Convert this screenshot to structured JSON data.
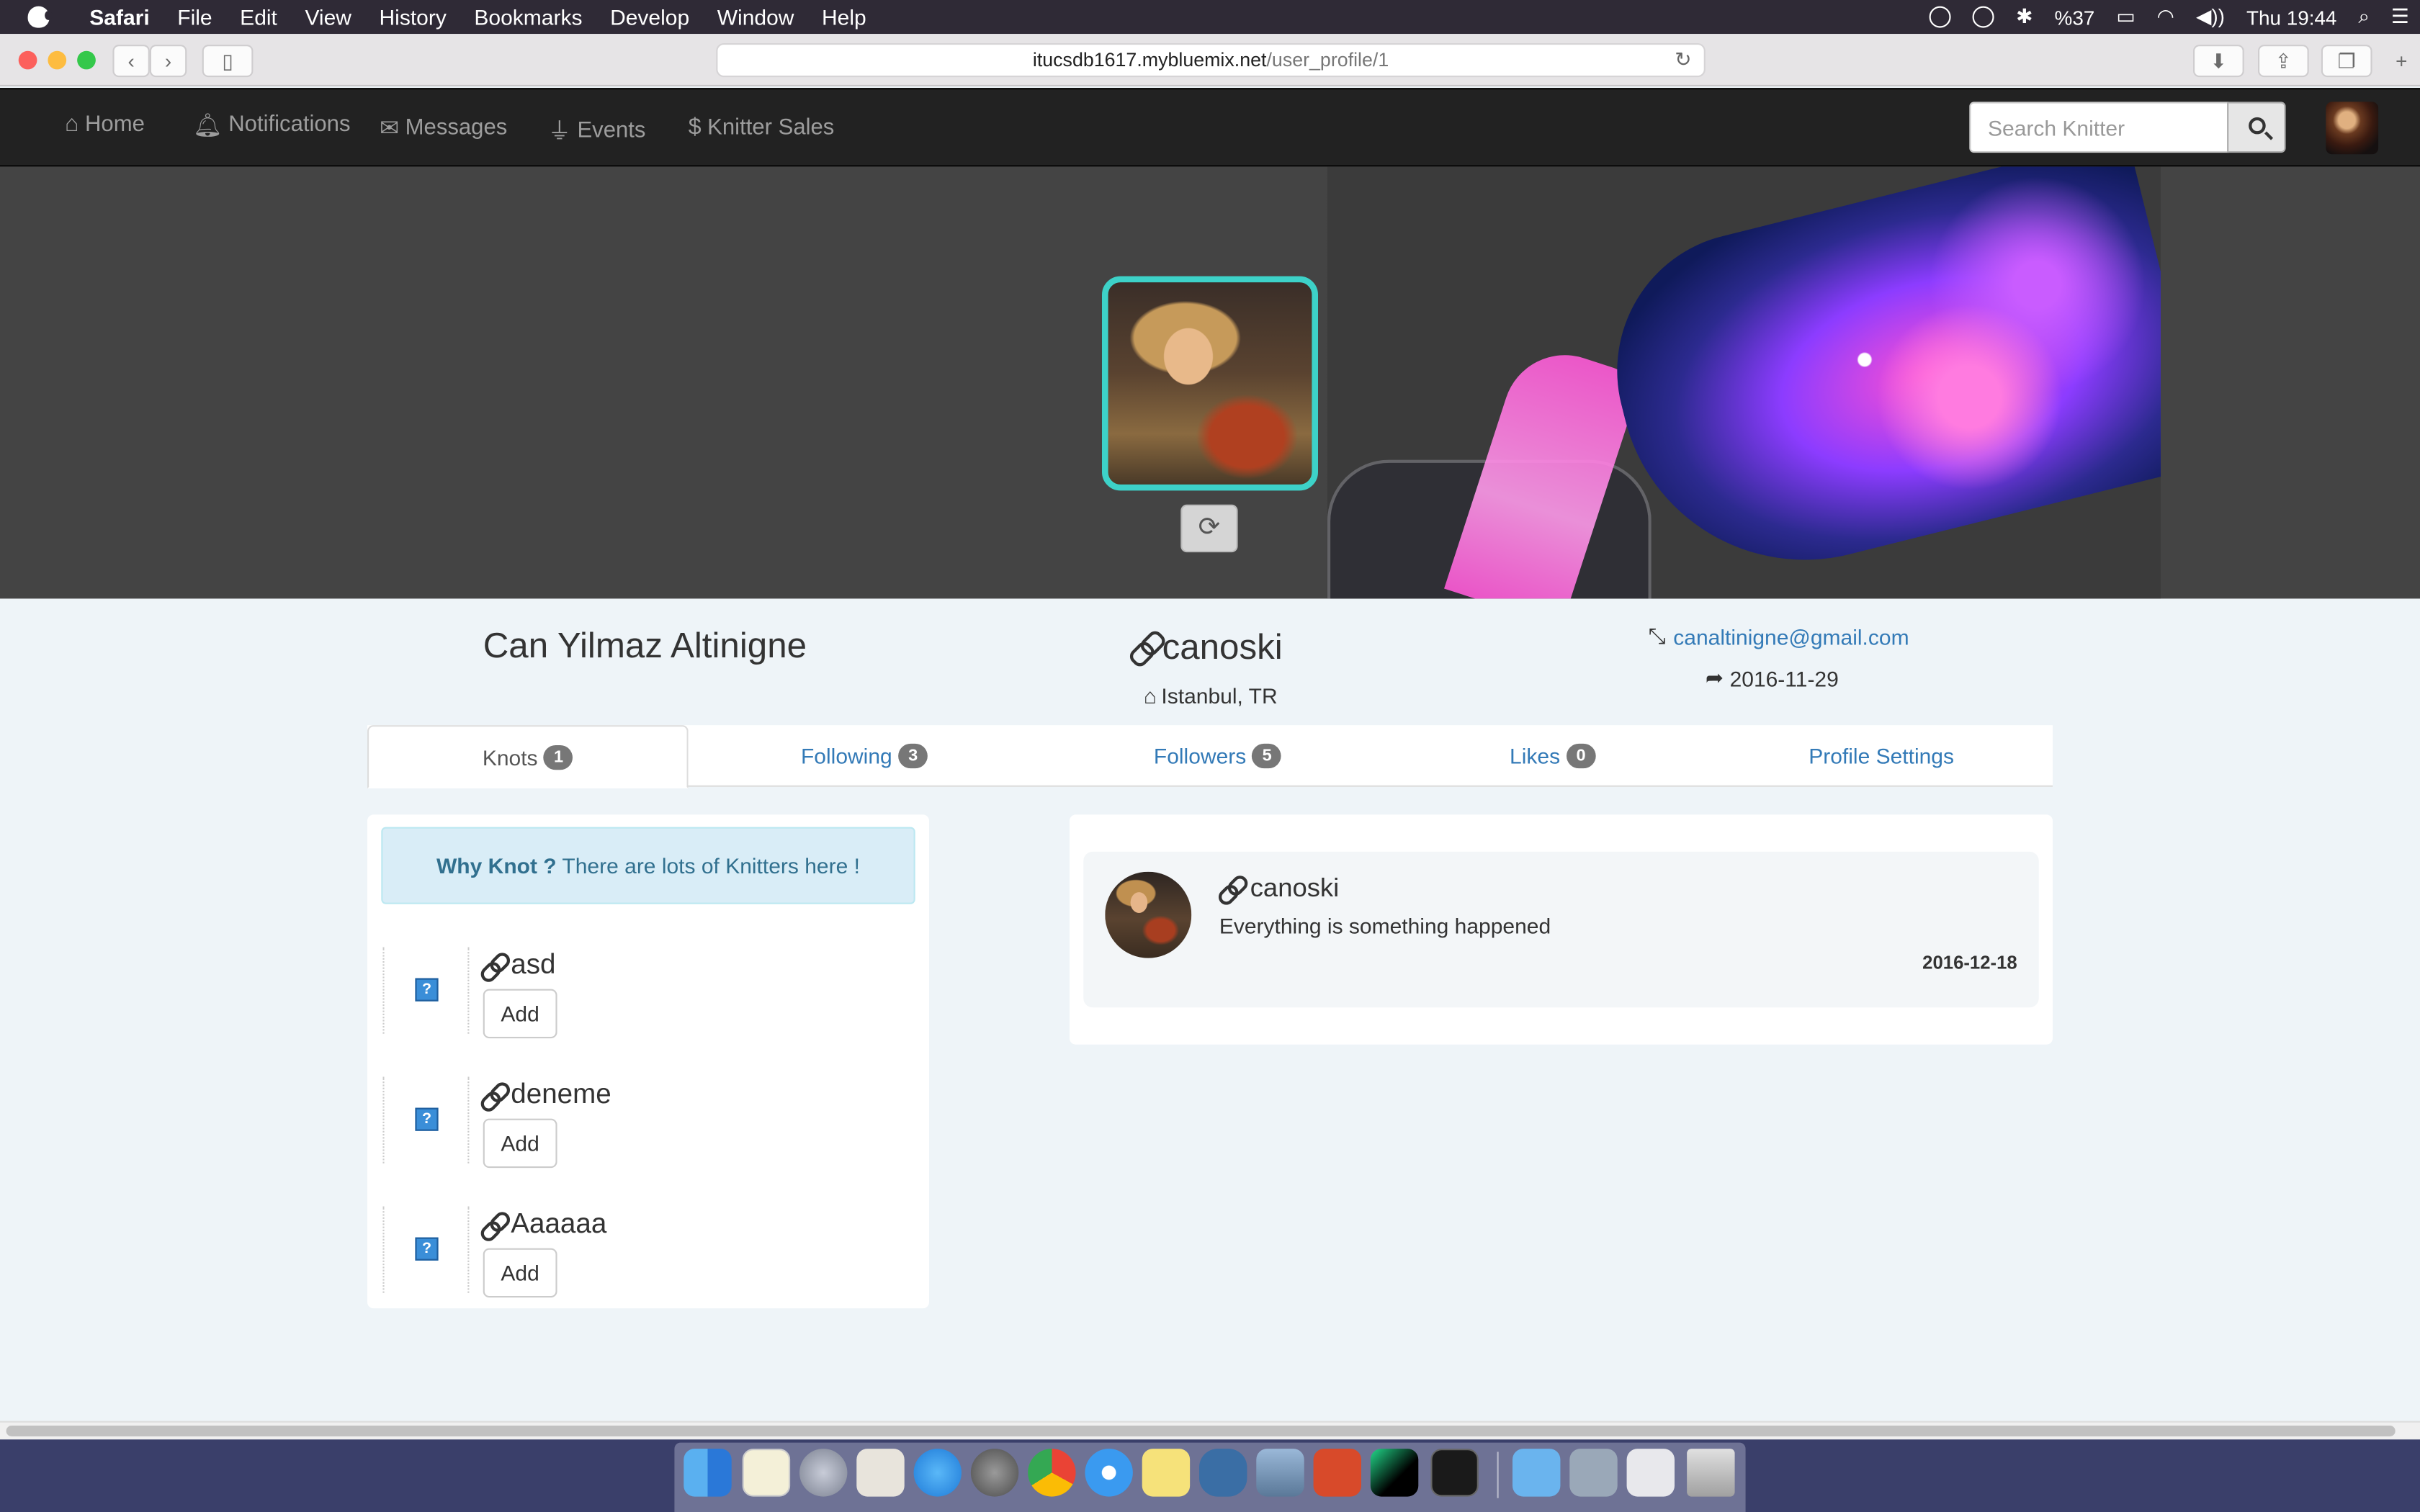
{
  "menubar": {
    "app": "Safari",
    "items": [
      "File",
      "Edit",
      "View",
      "History",
      "Bookmarks",
      "Develop",
      "Window",
      "Help"
    ],
    "battery": "%37",
    "clock": "Thu 19:44"
  },
  "browser": {
    "url_host": "itucsdb1617.mybluemix.net",
    "url_path": "/user_profile/1"
  },
  "nav": {
    "home": "Home",
    "notifications": "Notifications",
    "messages": "Messages",
    "events": "Events",
    "sales": "Knitter Sales",
    "search_placeholder": "Search Knitter"
  },
  "profile": {
    "full_name": "Can Yilmaz Altinigne",
    "username": "canoski",
    "location": "Istanbul, TR",
    "email": "canaltinigne@gmail.com",
    "joined": "2016-11-29"
  },
  "tabs": [
    {
      "label": "Knots",
      "count": "1"
    },
    {
      "label": "Following",
      "count": "3"
    },
    {
      "label": "Followers",
      "count": "5"
    },
    {
      "label": "Likes",
      "count": "0"
    },
    {
      "label": "Profile Settings"
    }
  ],
  "suggestions": {
    "header_bold": "Why Knot ?",
    "header_text": " There are lots of Knitters here !",
    "add_label": "Add",
    "users": [
      "asd",
      "deneme",
      "Aaaaaa"
    ]
  },
  "knot": {
    "user": "canoski",
    "text": "Everything is something happened",
    "date": "2016-12-18"
  },
  "colors": {
    "navbar": "#222222",
    "link": "#337ab7",
    "photo_border": "#3dd2c8",
    "info_box": "#d9edf7"
  }
}
